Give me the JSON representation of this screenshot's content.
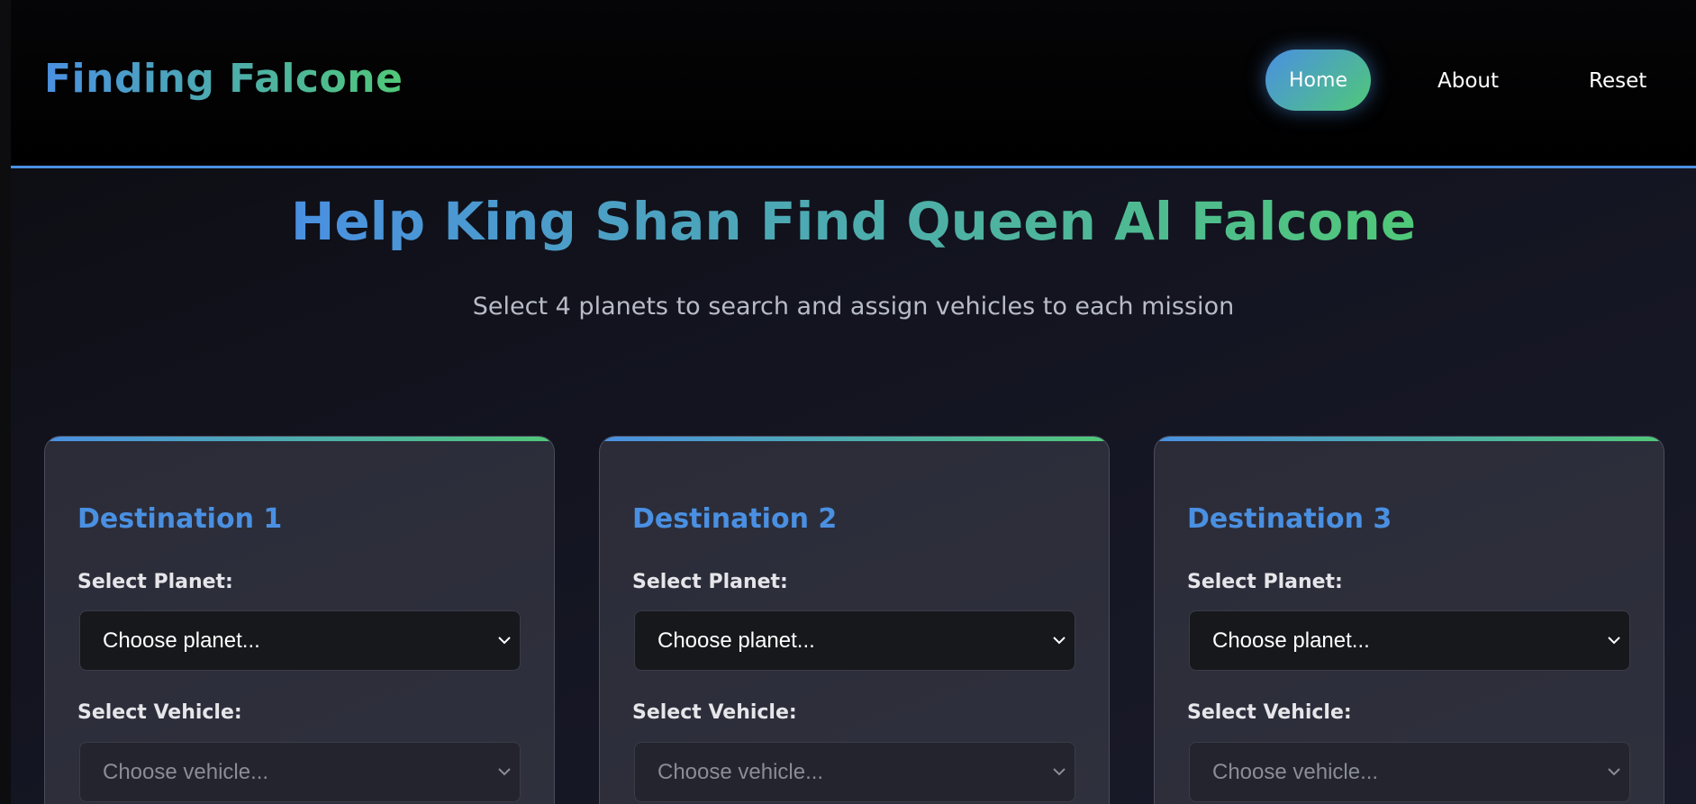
{
  "header": {
    "brand": "Finding Falcone",
    "nav": {
      "home": "Home",
      "about": "About",
      "reset": "Reset"
    }
  },
  "hero": {
    "title": "Help King Shan Find Queen Al Falcone",
    "subtitle": "Select 4 planets to search and assign vehicles to each mission"
  },
  "destinations": [
    {
      "title": "Destination 1",
      "planet_label": "Select Planet:",
      "planet_value": "Choose planet...",
      "vehicle_label": "Select Vehicle:",
      "vehicle_value": "Choose vehicle..."
    },
    {
      "title": "Destination 2",
      "planet_label": "Select Planet:",
      "planet_value": "Choose planet...",
      "vehicle_label": "Select Vehicle:",
      "vehicle_value": "Choose vehicle..."
    },
    {
      "title": "Destination 3",
      "planet_label": "Select Planet:",
      "planet_value": "Choose planet...",
      "vehicle_label": "Select Vehicle:",
      "vehicle_value": "Choose vehicle..."
    }
  ],
  "colors": {
    "accent_blue": "#4a90e2",
    "accent_green": "#50c878",
    "background": "#131420",
    "card": "#2b2c38"
  },
  "icons": {
    "select_chevron": "chevron-down-icon"
  }
}
